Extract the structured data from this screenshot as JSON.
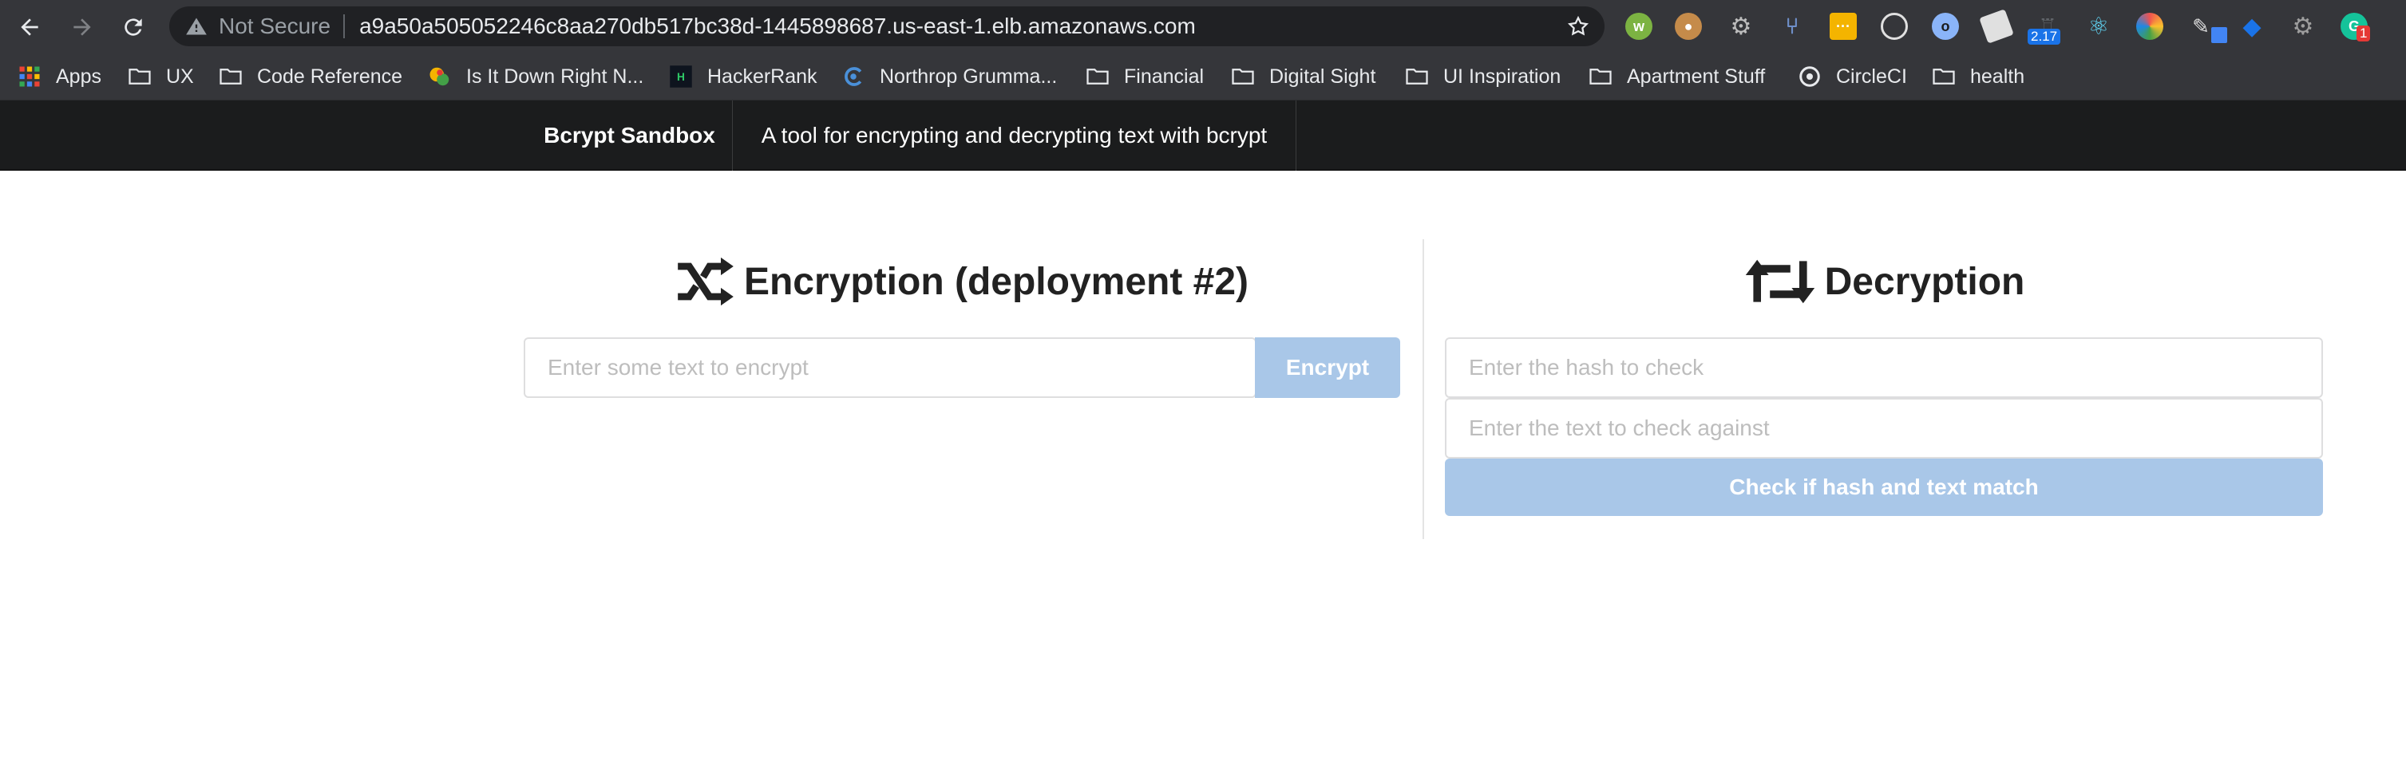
{
  "browser": {
    "security_label": "Not Secure",
    "url": "a9a50a505052246c8aa270db517bc38d-1445898687.us-east-1.elb.amazonaws.com",
    "extensions": [
      {
        "icon": "w-extension-icon",
        "letter": "w",
        "color": "#7cb342"
      },
      {
        "icon": "cookie-icon",
        "color": "#c58b4a"
      },
      {
        "icon": "gear-extension-icon",
        "color": "#bdbdbd"
      },
      {
        "icon": "branch-icon",
        "color": "#6f8fc9"
      },
      {
        "icon": "dots-extension-icon",
        "color": "#f4b400"
      },
      {
        "icon": "target-icon",
        "color": "#e0e0e0"
      },
      {
        "icon": "circle-o-icon",
        "color": "#8ab4f8"
      },
      {
        "icon": "eraser-icon",
        "color": "#e0e0e0"
      },
      {
        "icon": "robot-icon",
        "color": "#5f6368",
        "badge": "2.17"
      },
      {
        "icon": "react-icon",
        "color": "#61dafb"
      },
      {
        "icon": "color-wheel-icon",
        "color": "#ef5350"
      },
      {
        "icon": "pen-icon",
        "color": "#e0e0e0"
      },
      {
        "icon": "diamond-icon",
        "color": "#1a73e8"
      },
      {
        "icon": "settings-icon",
        "color": "#9e9e9e"
      },
      {
        "icon": "grammarly-icon",
        "color": "#15c39a",
        "badge": "1"
      }
    ]
  },
  "bookmarks": [
    {
      "label": "Apps",
      "icon": "apps-grid-icon"
    },
    {
      "label": "UX",
      "icon": "folder-icon"
    },
    {
      "label": "Code Reference",
      "icon": "folder-icon"
    },
    {
      "label": "Is It Down Right N...",
      "icon": "site-favicon-icon"
    },
    {
      "label": "HackerRank",
      "icon": "hackerrank-icon"
    },
    {
      "label": "Northrop Grumma...",
      "icon": "northrop-icon"
    },
    {
      "label": "Financial",
      "icon": "folder-icon"
    },
    {
      "label": "Digital Sight",
      "icon": "folder-icon"
    },
    {
      "label": "UI Inspiration",
      "icon": "folder-icon"
    },
    {
      "label": "Apartment Stuff",
      "icon": "folder-icon"
    },
    {
      "label": "CircleCI",
      "icon": "circleci-icon"
    },
    {
      "label": "health",
      "icon": "folder-icon"
    }
  ],
  "navbar": {
    "brand": "Bcrypt Sandbox",
    "tagline": "A tool for encrypting and decrypting text with bcrypt"
  },
  "encryption": {
    "title": "Encryption (deployment #2)",
    "input_placeholder": "Enter some text to encrypt",
    "button_label": "Encrypt"
  },
  "decryption": {
    "title": "Decryption",
    "hash_placeholder": "Enter the hash to check",
    "text_placeholder": "Enter the text to check against",
    "button_label": "Check if hash and text match"
  }
}
